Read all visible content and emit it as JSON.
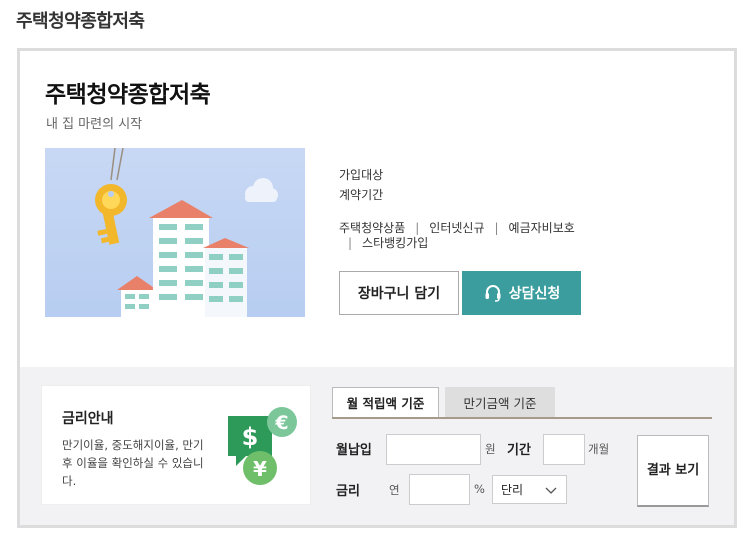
{
  "page": {
    "heading": "주택청약종합저축"
  },
  "product": {
    "title": "주택청약종합저축",
    "subtitle": "내 집 마련의 시작",
    "info_labels": [
      "가입대상",
      "계약기간"
    ],
    "links": [
      "주택청약상품",
      "인터넷신규",
      "예금자비보호",
      "스타뱅킹가입"
    ],
    "link_separator": "|",
    "cart_button": "장바구니 담기",
    "consult_button": "상담신청"
  },
  "rate_info": {
    "title": "금리안내",
    "description": "만기이율, 중도해지이율, 만기후 이율을 확인하실 수 있습니다."
  },
  "calculator": {
    "tabs": [
      "월 적립액 기준",
      "만기금액 기준"
    ],
    "active_tab": "월 적립액 기준",
    "monthly_label": "월납입",
    "monthly_value": "",
    "won_unit": "원",
    "period_label": "기간",
    "period_value": "",
    "month_unit": "개월",
    "rate_label": "금리",
    "annual_label": "연",
    "rate_value": "",
    "percent_unit": "%",
    "interest_type": "단리",
    "result_button": "결과 보기"
  },
  "colors": {
    "accent_teal": "#3b9d9d",
    "money_green": "#2e9a5a",
    "illustration_sky": "#b7cdf1",
    "tab_underline": "#a69a8a"
  },
  "icons": {
    "consult": "headset-icon",
    "rate": "money-currency-icon",
    "select": "chevron-down-icon"
  }
}
